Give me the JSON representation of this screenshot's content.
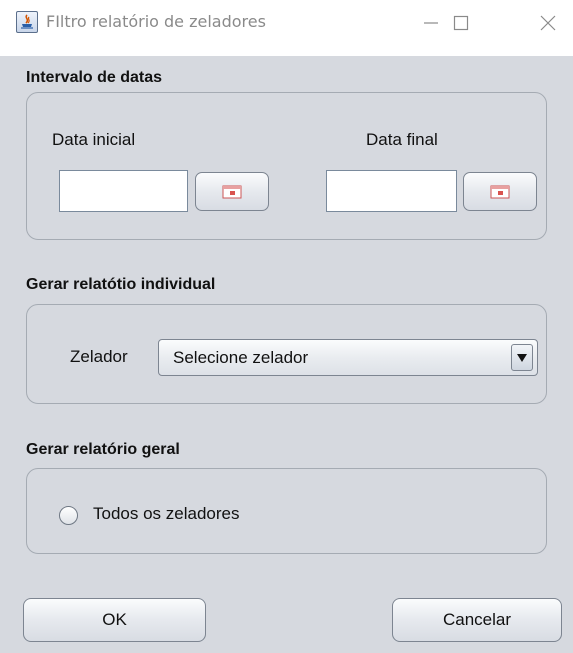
{
  "window": {
    "title": "FIltro relatório de zeladores",
    "app_icon": "java-icon",
    "controls": [
      "minimize-icon",
      "maximize-icon",
      "close-icon"
    ]
  },
  "date_range": {
    "section_title": "Intervalo de datas",
    "start_label": "Data inicial",
    "start_value": "",
    "end_label": "Data final",
    "end_value": "",
    "calendar_icon": "calendar-icon"
  },
  "individual": {
    "section_title": "Gerar relatótio individual",
    "zelador_label": "Zelador",
    "zelador_selected": "Selecione zelador"
  },
  "general": {
    "section_title": "Gerar relatório geral",
    "all_label": "Todos os zeladores",
    "all_checked": false
  },
  "buttons": {
    "ok": "OK",
    "cancel": "Cancelar"
  },
  "colors": {
    "dialog_bg": "#d6d9df",
    "calendar_red": "#d9534f"
  }
}
